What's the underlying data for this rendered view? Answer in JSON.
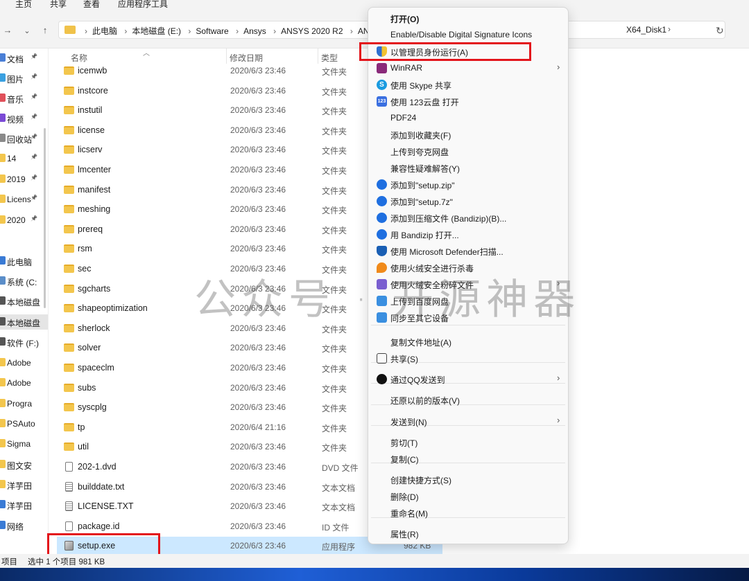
{
  "ribbon": {
    "tabs": [
      "主页",
      "共享",
      "查看",
      "应用程序工具"
    ]
  },
  "address": {
    "crumbs": [
      "此电脑",
      "本地磁盘 (E:)",
      "Software",
      "Ansys",
      "ANSYS 2020 R2",
      "ANSY"
    ],
    "tail": "X64_Disk1"
  },
  "nav_pane": {
    "items": [
      {
        "label": "文档",
        "pinned": true,
        "color": "#4a7fd6"
      },
      {
        "label": "图片",
        "pinned": true,
        "color": "#3aa0e0"
      },
      {
        "label": "音乐",
        "pinned": true,
        "color": "#e0505a"
      },
      {
        "label": "视频",
        "pinned": true,
        "color": "#7b4ad6"
      },
      {
        "label": "回收站",
        "pinned": true,
        "color": "#8a8a8a"
      },
      {
        "label": "14",
        "pinned": true,
        "color": "#f3c64d"
      },
      {
        "label": "2019",
        "pinned": true,
        "color": "#f3c64d"
      },
      {
        "label": "Licens",
        "pinned": true,
        "color": "#f3c64d"
      },
      {
        "label": "2020",
        "pinned": true,
        "color": "#f3c64d"
      },
      {
        "label": "此电脑",
        "pinned": false,
        "color": "#3a7bd5"
      },
      {
        "label": "系统 (C:",
        "pinned": false,
        "color": "#5b8ec9"
      },
      {
        "label": "本地磁盘",
        "pinned": false,
        "color": "#555555"
      },
      {
        "label": "本地磁盘",
        "pinned": false,
        "color": "#555555",
        "selected": true
      },
      {
        "label": "软件 (F:)",
        "pinned": false,
        "color": "#555555"
      },
      {
        "label": "Adobe",
        "pinned": false,
        "color": "#f3c64d"
      },
      {
        "label": "Adobe",
        "pinned": false,
        "color": "#f3c64d"
      },
      {
        "label": "Progra",
        "pinned": false,
        "color": "#f3c64d"
      },
      {
        "label": "PSAuto",
        "pinned": false,
        "color": "#f3c64d"
      },
      {
        "label": "Sigma",
        "pinned": false,
        "color": "#f3c64d"
      },
      {
        "label": "图文安",
        "pinned": false,
        "color": "#f3c64d"
      },
      {
        "label": "洋芋田",
        "pinned": false,
        "color": "#f3c64d"
      },
      {
        "label": "洋芋田",
        "pinned": false,
        "color": "#3a7bd5"
      },
      {
        "label": "网络",
        "pinned": false,
        "color": "#3a7bd5"
      }
    ]
  },
  "columns": {
    "name": "名称",
    "date": "修改日期",
    "type": "类型"
  },
  "files": [
    {
      "name": "icemwb",
      "date": "2020/6/3 23:46",
      "type": "文件夹",
      "size": "",
      "icon": "folder"
    },
    {
      "name": "instcore",
      "date": "2020/6/3 23:46",
      "type": "文件夹",
      "size": "",
      "icon": "folder"
    },
    {
      "name": "instutil",
      "date": "2020/6/3 23:46",
      "type": "文件夹",
      "size": "",
      "icon": "folder"
    },
    {
      "name": "license",
      "date": "2020/6/3 23:46",
      "type": "文件夹",
      "size": "",
      "icon": "folder"
    },
    {
      "name": "licserv",
      "date": "2020/6/3 23:46",
      "type": "文件夹",
      "size": "",
      "icon": "folder"
    },
    {
      "name": "lmcenter",
      "date": "2020/6/3 23:46",
      "type": "文件夹",
      "size": "",
      "icon": "folder"
    },
    {
      "name": "manifest",
      "date": "2020/6/3 23:46",
      "type": "文件夹",
      "size": "",
      "icon": "folder"
    },
    {
      "name": "meshing",
      "date": "2020/6/3 23:46",
      "type": "文件夹",
      "size": "",
      "icon": "folder"
    },
    {
      "name": "prereq",
      "date": "2020/6/3 23:46",
      "type": "文件夹",
      "size": "",
      "icon": "folder"
    },
    {
      "name": "rsm",
      "date": "2020/6/3 23:46",
      "type": "文件夹",
      "size": "",
      "icon": "folder"
    },
    {
      "name": "sec",
      "date": "2020/6/3 23:46",
      "type": "文件夹",
      "size": "",
      "icon": "folder"
    },
    {
      "name": "sgcharts",
      "date": "2020/6/3 23:46",
      "type": "文件夹",
      "size": "",
      "icon": "folder"
    },
    {
      "name": "shapeoptimization",
      "date": "2020/6/3 23:46",
      "type": "文件夹",
      "size": "",
      "icon": "folder"
    },
    {
      "name": "sherlock",
      "date": "2020/6/3 23:46",
      "type": "文件夹",
      "size": "",
      "icon": "folder"
    },
    {
      "name": "solver",
      "date": "2020/6/3 23:46",
      "type": "文件夹",
      "size": "",
      "icon": "folder"
    },
    {
      "name": "spaceclm",
      "date": "2020/6/3 23:46",
      "type": "文件夹",
      "size": "",
      "icon": "folder"
    },
    {
      "name": "subs",
      "date": "2020/6/3 23:46",
      "type": "文件夹",
      "size": "",
      "icon": "folder"
    },
    {
      "name": "syscplg",
      "date": "2020/6/3 23:46",
      "type": "文件夹",
      "size": "",
      "icon": "folder"
    },
    {
      "name": "tp",
      "date": "2020/6/4 21:16",
      "type": "文件夹",
      "size": "",
      "icon": "folder"
    },
    {
      "name": "util",
      "date": "2020/6/3 23:46",
      "type": "文件夹",
      "size": "",
      "icon": "folder"
    },
    {
      "name": "202-1.dvd",
      "date": "2020/6/3 23:46",
      "type": "DVD 文件",
      "size": "",
      "icon": "doc"
    },
    {
      "name": "builddate.txt",
      "date": "2020/6/3 23:46",
      "type": "文本文档",
      "size": "",
      "icon": "txt"
    },
    {
      "name": "LICENSE.TXT",
      "date": "2020/6/3 23:46",
      "type": "文本文档",
      "size": "",
      "icon": "txt"
    },
    {
      "name": "package.id",
      "date": "2020/6/3 23:46",
      "type": "ID 文件",
      "size": "",
      "icon": "doc"
    },
    {
      "name": "setup.exe",
      "date": "2020/6/3 23:46",
      "type": "应用程序",
      "size": "982 KB",
      "icon": "exe",
      "selected": true
    }
  ],
  "status": {
    "items": "项目",
    "selected": "选中 1 个项目  981 KB"
  },
  "context_menu": {
    "items": [
      {
        "label": "打开(O)",
        "bold": true,
        "icon": "",
        "color": ""
      },
      {
        "label": "Enable/Disable Digital Signature Icons",
        "icon": "",
        "color": ""
      },
      {
        "label": "以管理员身份运行(A)",
        "icon": "shield-icon",
        "color": "#2f6fd0"
      },
      {
        "label": "WinRAR",
        "icon": "winrar-icon",
        "color": "#8a2a7a",
        "submenu": true
      },
      {
        "label": "使用 Skype 共享",
        "icon": "skype-icon",
        "color": "#1a9be0",
        "glyph": "S"
      },
      {
        "label": "使用 123云盘 打开",
        "icon": "cloud123-icon",
        "color": "#3a6fe0",
        "glyph": "123"
      },
      {
        "label": "PDF24",
        "icon": "",
        "color": ""
      },
      {
        "label": "添加到收藏夹(F)",
        "icon": "",
        "color": ""
      },
      {
        "label": "上传到夸克网盘",
        "icon": "",
        "color": ""
      },
      {
        "label": "兼容性疑难解答(Y)",
        "icon": "",
        "color": ""
      },
      {
        "label": "添加到\"setup.zip\"",
        "icon": "bandizip-icon",
        "color": "#1f6fe0"
      },
      {
        "label": "添加到\"setup.7z\"",
        "icon": "bandizip-icon",
        "color": "#1f6fe0"
      },
      {
        "label": "添加到压缩文件 (Bandizip)(B)...",
        "icon": "bandizip-icon",
        "color": "#1f6fe0"
      },
      {
        "label": "用 Bandizip 打开...",
        "icon": "bandizip-icon",
        "color": "#1f6fe0"
      },
      {
        "label": "使用 Microsoft Defender扫描...",
        "icon": "defender-icon",
        "color": "#1a5fb4"
      },
      {
        "label": "使用火绒安全进行杀毒",
        "icon": "huorong-icon",
        "color": "#f08a1a"
      },
      {
        "label": "使用火绒安全粉碎文件",
        "icon": "huorong-shred-icon",
        "color": "#7a5fd0",
        "submenu": true
      },
      {
        "label": "上传到百度网盘",
        "icon": "baidu-icon",
        "color": "#3a8fe0"
      },
      {
        "label": "同步至其它设备",
        "icon": "baidu-icon",
        "color": "#3a8fe0"
      },
      {
        "label": "复制文件地址(A)",
        "icon": "",
        "color": ""
      },
      {
        "label": "共享(S)",
        "icon": "share-icon",
        "color": "#444444"
      },
      {
        "label": "通过QQ发送到",
        "icon": "qq-icon",
        "color": "#111111",
        "submenu": true
      },
      {
        "label": "还原以前的版本(V)",
        "icon": "",
        "color": ""
      },
      {
        "label": "发送到(N)",
        "icon": "",
        "color": "",
        "submenu": true
      },
      {
        "label": "剪切(T)",
        "icon": "",
        "color": ""
      },
      {
        "label": "复制(C)",
        "icon": "",
        "color": ""
      },
      {
        "label": "创建快捷方式(S)",
        "icon": "",
        "color": ""
      },
      {
        "label": "删除(D)",
        "icon": "",
        "color": ""
      },
      {
        "label": "重命名(M)",
        "icon": "",
        "color": ""
      },
      {
        "label": "属性(R)",
        "icon": "",
        "color": ""
      }
    ]
  },
  "watermark": "公众号 · 开源神器",
  "colors": {
    "highlight_red": "#e3141b",
    "selection_blue": "#cce8ff"
  }
}
